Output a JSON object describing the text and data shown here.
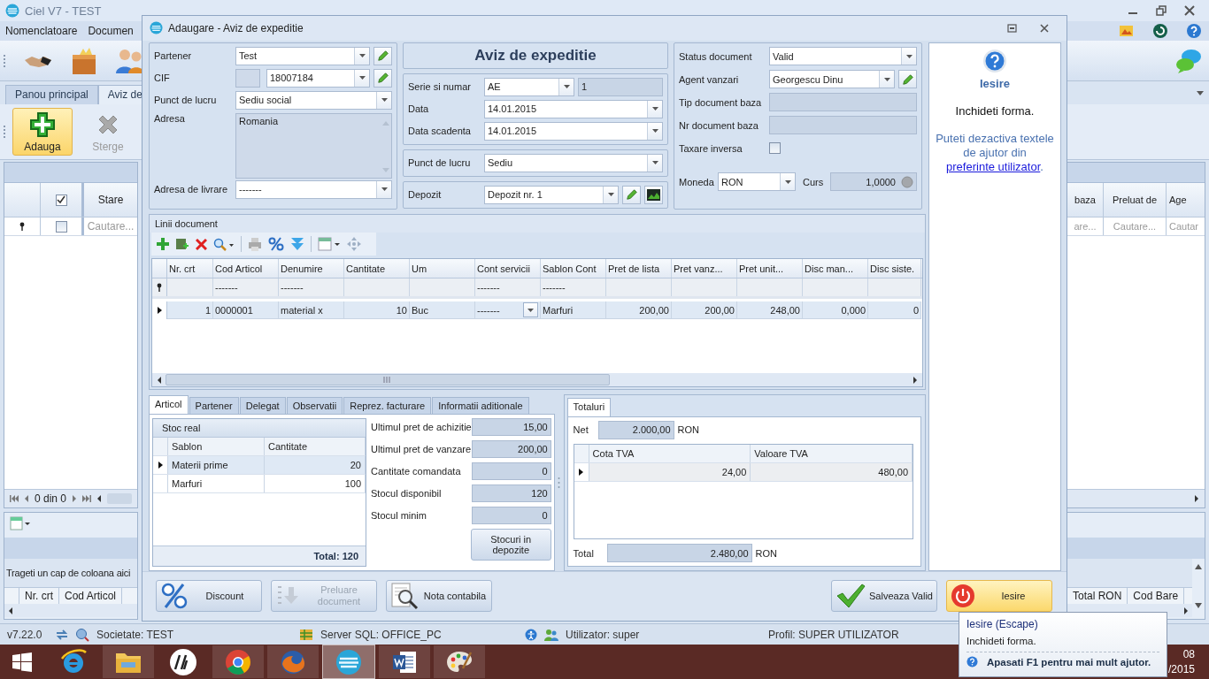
{
  "app": {
    "title": "Ciel V7 - TEST",
    "menu": [
      "Nomenclatoare",
      "Documen"
    ],
    "tabs": [
      {
        "label": "Panou principal",
        "selected": false
      },
      {
        "label": "Aviz de",
        "selected": true
      }
    ],
    "ribbon": [
      {
        "label": "Adauga",
        "kind": "add",
        "highlighted": true,
        "disabled": false
      },
      {
        "label": "Sterge",
        "kind": "delete",
        "highlighted": false,
        "disabled": true
      }
    ],
    "grid": {
      "select_all": true,
      "column": "Stare",
      "filter_checked": false,
      "filter_hint": "Cautare...",
      "pager": "0 din 0"
    },
    "grid_right": [
      {
        "label": "baza",
        "filter_hint": "are..."
      },
      {
        "label": "Preluat de",
        "filter_hint": "Cautare..."
      },
      {
        "label": "Age",
        "filter_hint": "Cautar"
      }
    ],
    "detail_grid": {
      "group_hint": "Trageti un cap de coloana aici",
      "columns": [
        "Nr. crt",
        "Cod Articol"
      ],
      "columns_right": [
        "Total RON",
        "Cod Bare"
      ]
    },
    "status_bar": [
      {
        "text": "v7.22.0",
        "kind": "version"
      },
      {
        "text": "Societate: TEST",
        "kind": "company"
      },
      {
        "text": "Server SQL: OFFICE_PC",
        "kind": "server"
      },
      {
        "text": "Utilizator: super",
        "kind": "user"
      },
      {
        "text": "Profil: SUPER UTILIZATOR",
        "kind": "profile"
      }
    ],
    "taskbar": {
      "apps": [
        {
          "kind": "browser",
          "active": false
        },
        {
          "kind": "folder",
          "active": false
        },
        {
          "kind": "circle_logo",
          "active": false
        },
        {
          "kind": "round_browser",
          "active": false
        },
        {
          "kind": "fox_browser",
          "active": false
        },
        {
          "kind": "ciel",
          "active": true
        },
        {
          "kind": "document",
          "active": false
        },
        {
          "kind": "palette",
          "active": false
        }
      ],
      "clock": [
        "08",
        "/2015"
      ]
    }
  },
  "dialog": {
    "title": "Adaugare - Aviz de expeditie",
    "heading": "Aviz de expeditie",
    "partner": [
      {
        "label": "Partener",
        "value": "Test",
        "kind": "combo",
        "edit_button": true
      },
      {
        "label": "CIF",
        "value": "18007184",
        "kind": "prefixed_combo",
        "edit_button": true
      },
      {
        "label": "Punct de lucru",
        "value": "Sediu social",
        "kind": "combo",
        "edit_button": false
      },
      {
        "label": "Adresa",
        "value": "Romania",
        "kind": "area"
      },
      {
        "label": "Adresa de livrare",
        "value": "-------",
        "kind": "combo",
        "edit_button": false
      }
    ],
    "document": [
      {
        "label": "Serie si numar",
        "value": "AE",
        "number": "1",
        "kind": "series"
      },
      {
        "label": "Data",
        "value": "14.01.2015",
        "kind": "combo",
        "edit_button": false
      },
      {
        "label": "Data scadenta",
        "value": "14.01.2015",
        "kind": "combo",
        "edit_button": false
      }
    ],
    "location": [
      {
        "label": "Punct de lucru",
        "value": "Sediu",
        "kind": "combo",
        "edit_button": false
      }
    ],
    "warehouse": [
      {
        "label": "Depozit",
        "value": "Depozit nr. 1",
        "kind": "combo",
        "edit_button": true,
        "chart_button": true
      }
    ],
    "status": [
      {
        "label": "Status document",
        "value": "Valid",
        "kind": "combo",
        "edit_button": false
      },
      {
        "label": "Agent vanzari",
        "value": "Georgescu Dinu",
        "kind": "combo",
        "edit_button": true
      },
      {
        "label": "Tip document baza",
        "kind": "readonly"
      },
      {
        "label": "Nr document baza",
        "kind": "readonly"
      },
      {
        "label": "Taxare inversa",
        "kind": "check",
        "checked": false
      },
      {
        "label": "Moneda",
        "value": "RON",
        "kind": "currency",
        "rate_label": "Curs",
        "rate": "1,0000"
      }
    ],
    "lines": {
      "title": "Linii document",
      "columns": [
        {
          "label": "Nr. crt"
        },
        {
          "label": "Cod Articol",
          "filter": "-------"
        },
        {
          "label": "Denumire",
          "filter": "-------"
        },
        {
          "label": "Cantitate"
        },
        {
          "label": "Um"
        },
        {
          "label": "Cont servicii",
          "filter": "-------",
          "kind": "combo"
        },
        {
          "label": "Sablon Cont",
          "filter": "-------"
        },
        {
          "label": "Pret de lista"
        },
        {
          "label": "Pret vanz..."
        },
        {
          "label": "Pret unit..."
        },
        {
          "label": "Disc man..."
        },
        {
          "label": "Disc siste."
        }
      ],
      "rows": [
        {
          "cells": [
            "1",
            "0000001",
            "material x",
            "10",
            "Buc",
            "-------",
            "Marfuri",
            "200,00",
            "200,00",
            "248,00",
            "0,000",
            "0"
          ],
          "selected": true
        }
      ]
    },
    "tabs": [
      {
        "label": "Articol",
        "selected": true
      },
      {
        "label": "Partener",
        "selected": false
      },
      {
        "label": "Delegat",
        "selected": false
      },
      {
        "label": "Observatii",
        "selected": false
      },
      {
        "label": "Reprez. facturare",
        "selected": false
      },
      {
        "label": "Informatii aditionale",
        "selected": false
      }
    ],
    "stock": {
      "title": "Stoc real",
      "columns": [
        "Sablon",
        "Cantitate"
      ],
      "rows": [
        {
          "cells": [
            "Materii prime",
            "20"
          ],
          "selected": true
        },
        {
          "cells": [
            "Marfuri",
            "100"
          ],
          "selected": false
        }
      ],
      "total": "Total: 120"
    },
    "info": [
      {
        "label": "Ultimul pret de achizitie",
        "value": "15,00"
      },
      {
        "label": "Ultimul pret de vanzare",
        "value": "200,00"
      },
      {
        "label": "Cantitate comandata",
        "value": "0"
      },
      {
        "label": "Stocul disponibil",
        "value": "120"
      },
      {
        "label": "Stocul minim",
        "value": "0"
      }
    ],
    "stock_button": "Stocuri in depozite",
    "totals": {
      "tab": "Totaluri",
      "net": {
        "label": "Net",
        "value": "2.000,00",
        "unit": "RON"
      },
      "columns": [
        "Cota TVA",
        "Valoare TVA"
      ],
      "rows": [
        {
          "cells": [
            "24,00",
            "480,00"
          ],
          "selected": true
        }
      ],
      "total": {
        "label": "Total",
        "value": "2.480,00",
        "unit": "RON"
      }
    },
    "buttons": [
      {
        "label": "Discount",
        "kind": "discount",
        "disabled": false,
        "hovered": false
      },
      {
        "label": "Preluare document",
        "kind": "import",
        "disabled": true,
        "hovered": false
      },
      {
        "label": "Nota contabila",
        "kind": "ledger",
        "disabled": false,
        "hovered": false
      },
      {
        "label": "Salveaza Valid",
        "kind": "save",
        "disabled": false,
        "hovered": false
      },
      {
        "label": "Iesire",
        "kind": "exit",
        "disabled": false,
        "hovered": true
      }
    ],
    "help": {
      "title": "Iesire",
      "text": "Inchideti forma.",
      "note": "Puteti dezactiva textele de ajutor din",
      "link": "preferinte utilizator",
      "note_end": "."
    }
  },
  "tooltip": {
    "title": "Iesire (Escape)",
    "text": "Inchideti forma.",
    "hint": "Apasati F1 pentru mai mult ajutor."
  }
}
